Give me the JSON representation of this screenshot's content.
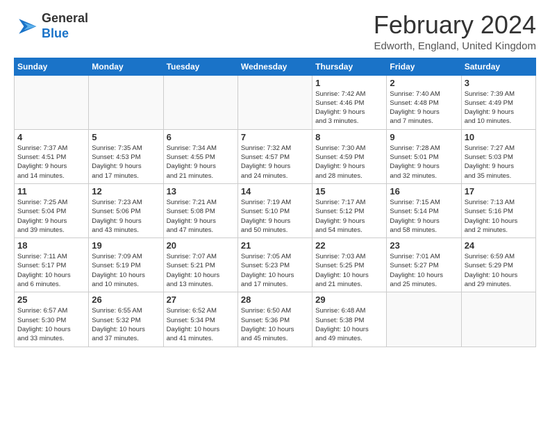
{
  "logo": {
    "line1": "General",
    "line2": "Blue"
  },
  "title": "February 2024",
  "subtitle": "Edworth, England, United Kingdom",
  "days_of_week": [
    "Sunday",
    "Monday",
    "Tuesday",
    "Wednesday",
    "Thursday",
    "Friday",
    "Saturday"
  ],
  "weeks": [
    [
      {
        "day": "",
        "info": ""
      },
      {
        "day": "",
        "info": ""
      },
      {
        "day": "",
        "info": ""
      },
      {
        "day": "",
        "info": ""
      },
      {
        "day": "1",
        "info": "Sunrise: 7:42 AM\nSunset: 4:46 PM\nDaylight: 9 hours\nand 3 minutes."
      },
      {
        "day": "2",
        "info": "Sunrise: 7:40 AM\nSunset: 4:48 PM\nDaylight: 9 hours\nand 7 minutes."
      },
      {
        "day": "3",
        "info": "Sunrise: 7:39 AM\nSunset: 4:49 PM\nDaylight: 9 hours\nand 10 minutes."
      }
    ],
    [
      {
        "day": "4",
        "info": "Sunrise: 7:37 AM\nSunset: 4:51 PM\nDaylight: 9 hours\nand 14 minutes."
      },
      {
        "day": "5",
        "info": "Sunrise: 7:35 AM\nSunset: 4:53 PM\nDaylight: 9 hours\nand 17 minutes."
      },
      {
        "day": "6",
        "info": "Sunrise: 7:34 AM\nSunset: 4:55 PM\nDaylight: 9 hours\nand 21 minutes."
      },
      {
        "day": "7",
        "info": "Sunrise: 7:32 AM\nSunset: 4:57 PM\nDaylight: 9 hours\nand 24 minutes."
      },
      {
        "day": "8",
        "info": "Sunrise: 7:30 AM\nSunset: 4:59 PM\nDaylight: 9 hours\nand 28 minutes."
      },
      {
        "day": "9",
        "info": "Sunrise: 7:28 AM\nSunset: 5:01 PM\nDaylight: 9 hours\nand 32 minutes."
      },
      {
        "day": "10",
        "info": "Sunrise: 7:27 AM\nSunset: 5:03 PM\nDaylight: 9 hours\nand 35 minutes."
      }
    ],
    [
      {
        "day": "11",
        "info": "Sunrise: 7:25 AM\nSunset: 5:04 PM\nDaylight: 9 hours\nand 39 minutes."
      },
      {
        "day": "12",
        "info": "Sunrise: 7:23 AM\nSunset: 5:06 PM\nDaylight: 9 hours\nand 43 minutes."
      },
      {
        "day": "13",
        "info": "Sunrise: 7:21 AM\nSunset: 5:08 PM\nDaylight: 9 hours\nand 47 minutes."
      },
      {
        "day": "14",
        "info": "Sunrise: 7:19 AM\nSunset: 5:10 PM\nDaylight: 9 hours\nand 50 minutes."
      },
      {
        "day": "15",
        "info": "Sunrise: 7:17 AM\nSunset: 5:12 PM\nDaylight: 9 hours\nand 54 minutes."
      },
      {
        "day": "16",
        "info": "Sunrise: 7:15 AM\nSunset: 5:14 PM\nDaylight: 9 hours\nand 58 minutes."
      },
      {
        "day": "17",
        "info": "Sunrise: 7:13 AM\nSunset: 5:16 PM\nDaylight: 10 hours\nand 2 minutes."
      }
    ],
    [
      {
        "day": "18",
        "info": "Sunrise: 7:11 AM\nSunset: 5:17 PM\nDaylight: 10 hours\nand 6 minutes."
      },
      {
        "day": "19",
        "info": "Sunrise: 7:09 AM\nSunset: 5:19 PM\nDaylight: 10 hours\nand 10 minutes."
      },
      {
        "day": "20",
        "info": "Sunrise: 7:07 AM\nSunset: 5:21 PM\nDaylight: 10 hours\nand 13 minutes."
      },
      {
        "day": "21",
        "info": "Sunrise: 7:05 AM\nSunset: 5:23 PM\nDaylight: 10 hours\nand 17 minutes."
      },
      {
        "day": "22",
        "info": "Sunrise: 7:03 AM\nSunset: 5:25 PM\nDaylight: 10 hours\nand 21 minutes."
      },
      {
        "day": "23",
        "info": "Sunrise: 7:01 AM\nSunset: 5:27 PM\nDaylight: 10 hours\nand 25 minutes."
      },
      {
        "day": "24",
        "info": "Sunrise: 6:59 AM\nSunset: 5:29 PM\nDaylight: 10 hours\nand 29 minutes."
      }
    ],
    [
      {
        "day": "25",
        "info": "Sunrise: 6:57 AM\nSunset: 5:30 PM\nDaylight: 10 hours\nand 33 minutes."
      },
      {
        "day": "26",
        "info": "Sunrise: 6:55 AM\nSunset: 5:32 PM\nDaylight: 10 hours\nand 37 minutes."
      },
      {
        "day": "27",
        "info": "Sunrise: 6:52 AM\nSunset: 5:34 PM\nDaylight: 10 hours\nand 41 minutes."
      },
      {
        "day": "28",
        "info": "Sunrise: 6:50 AM\nSunset: 5:36 PM\nDaylight: 10 hours\nand 45 minutes."
      },
      {
        "day": "29",
        "info": "Sunrise: 6:48 AM\nSunset: 5:38 PM\nDaylight: 10 hours\nand 49 minutes."
      },
      {
        "day": "",
        "info": ""
      },
      {
        "day": "",
        "info": ""
      }
    ]
  ]
}
